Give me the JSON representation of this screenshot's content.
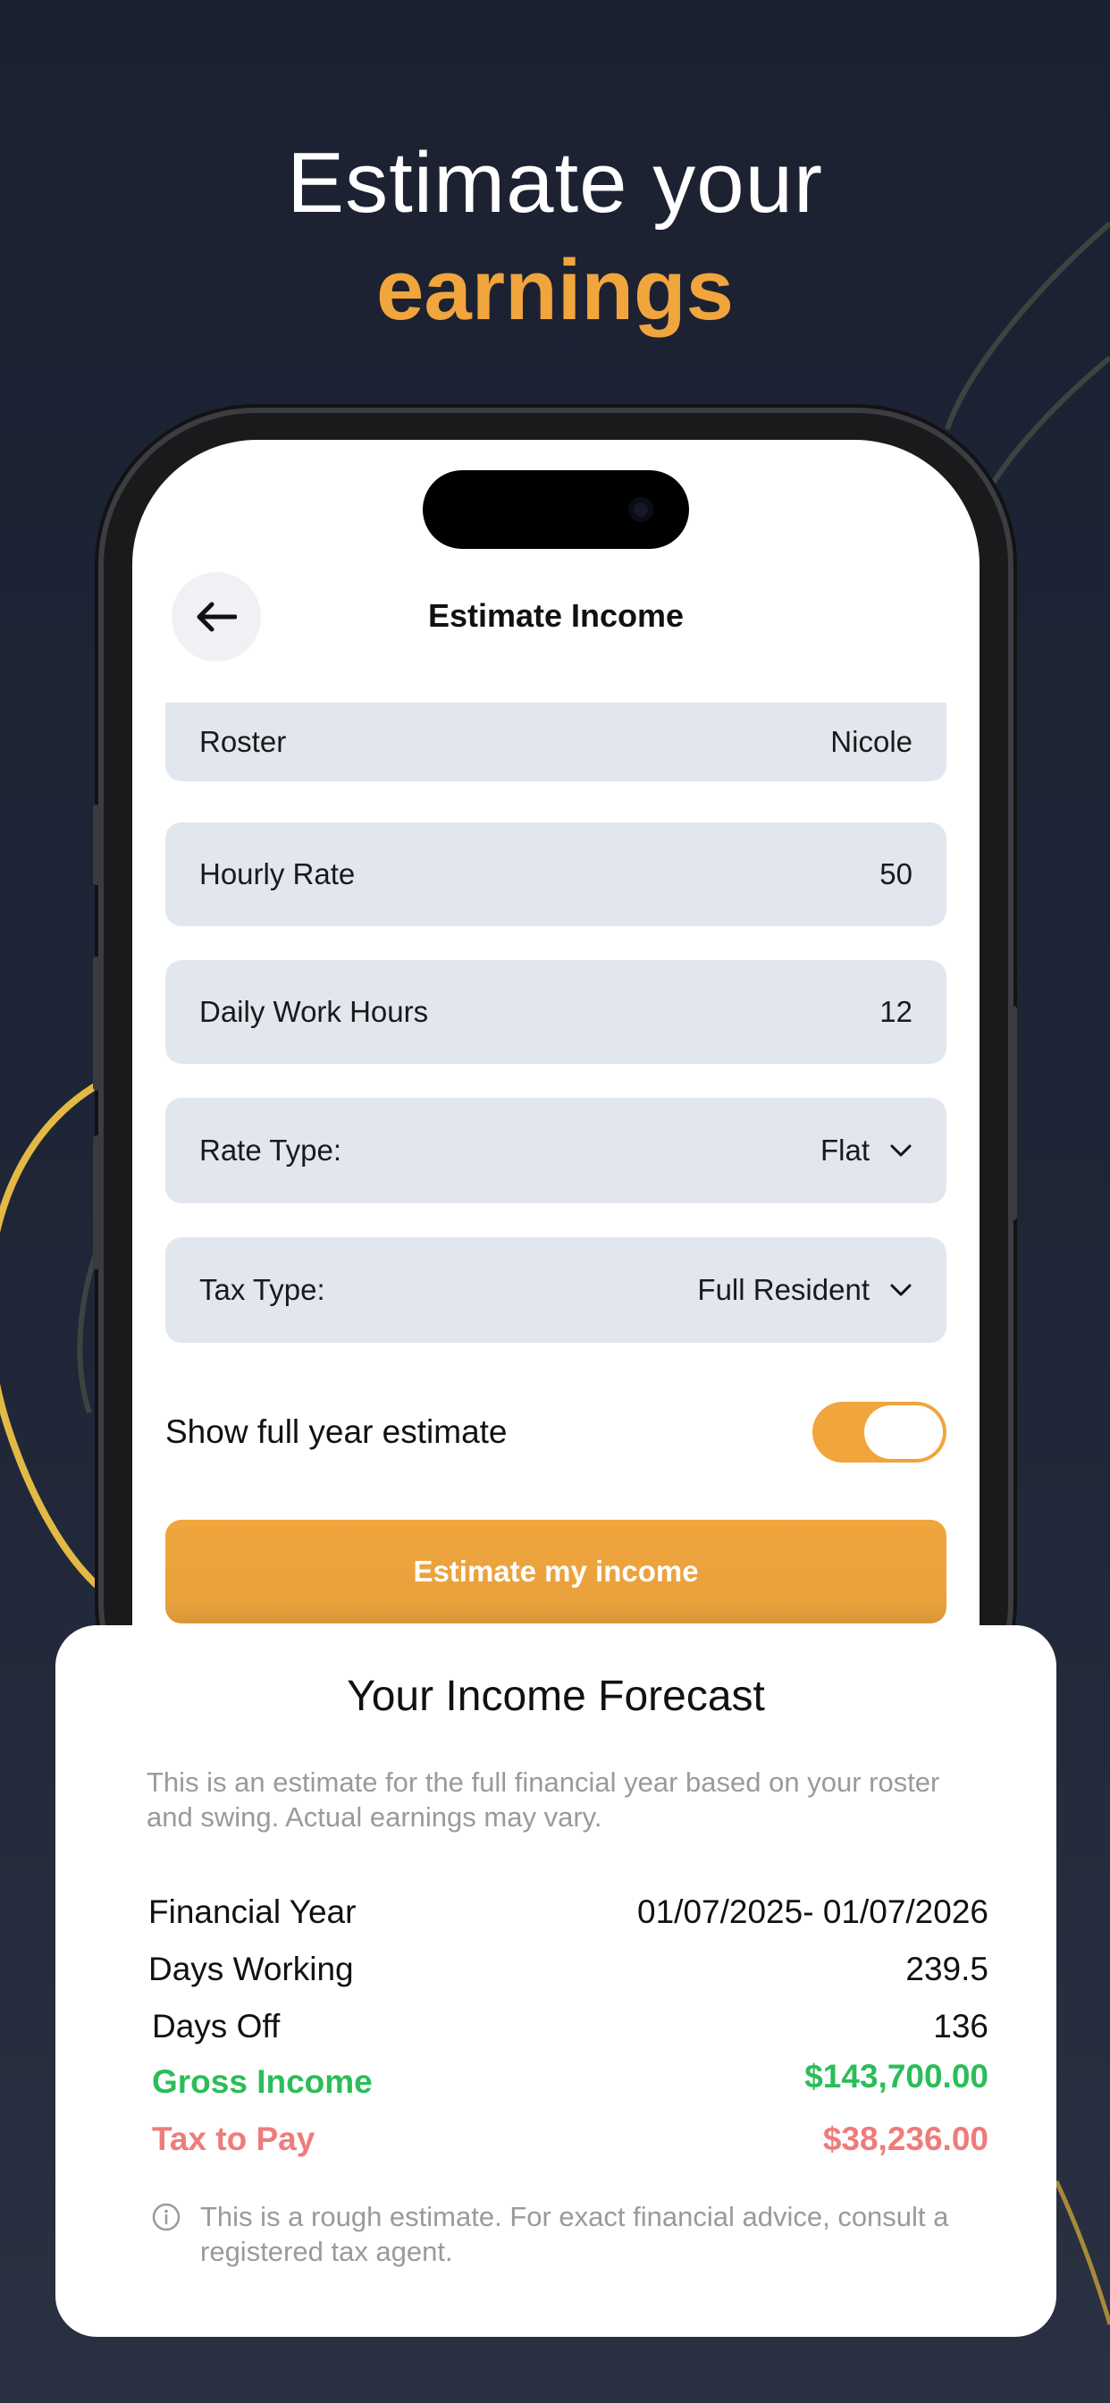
{
  "headline": {
    "line1": "Estimate your",
    "line2": "earnings"
  },
  "screen": {
    "title": "Estimate Income",
    "fields": [
      {
        "label": "Roster",
        "value": "Nicole",
        "dropdown": false
      },
      {
        "label": "Hourly Rate",
        "value": "50",
        "dropdown": false
      },
      {
        "label": "Daily Work Hours",
        "value": "12",
        "dropdown": false
      },
      {
        "label": "Rate Type:",
        "value": "Flat",
        "dropdown": true
      },
      {
        "label": "Tax Type:",
        "value": "Full Resident",
        "dropdown": true
      }
    ],
    "toggle": {
      "label": "Show full year estimate",
      "on": true
    },
    "cta": "Estimate my income"
  },
  "forecast": {
    "title": "Your Income Forecast",
    "description": "This is an estimate for the full financial year based on your roster and swing. Actual earnings may vary.",
    "rows": [
      {
        "label": "Financial Year",
        "value": "01/07/2025- 01/07/2026"
      },
      {
        "label": "Days Working",
        "value": "239.5"
      },
      {
        "label": "Days Off",
        "value": "136"
      },
      {
        "label": "Gross Income",
        "value": "$143,700.00"
      },
      {
        "label": "Tax to Pay",
        "value": "$38,236.00"
      }
    ],
    "note": "This is a rough estimate. For exact financial advice, consult a registered tax agent."
  },
  "colors": {
    "accent": "#f0a53d",
    "gross": "#2bbd58",
    "tax": "#ef7b7b",
    "field_bg": "#e1e6ef"
  }
}
